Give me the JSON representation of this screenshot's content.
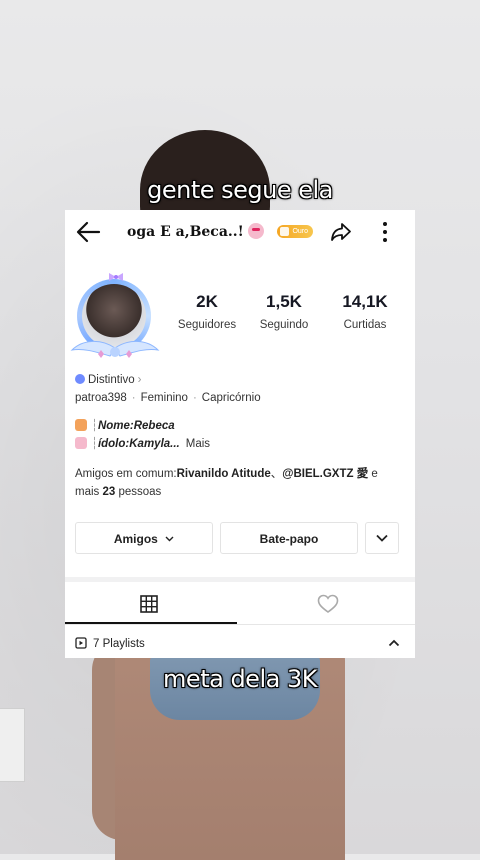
{
  "captions": {
    "top": "gente segue ela",
    "bottom": "meta dela 3K"
  },
  "profile": {
    "title": "oga E a,Beca..!",
    "badge": "Ouro",
    "stats": [
      {
        "value": "2K",
        "label": "Seguidores"
      },
      {
        "value": "1,5K",
        "label": "Seguindo"
      },
      {
        "value": "14,1K",
        "label": "Curtidas"
      }
    ],
    "distinctive": "Distintivo",
    "meta": [
      "patroa398",
      "Feminino",
      "Capricórnio"
    ],
    "bio": {
      "line1_key": "Nome",
      "line1_value": "Rebeca",
      "line2_key": "ídolo",
      "line2_value": "Kamyla...",
      "more": "Mais"
    },
    "friends": {
      "prefix": "Amigos em comum:",
      "name1": "Rivanildo Atitude",
      "sep": "、",
      "name2": "@BIEL.GXTZ 愛",
      "suffix1": " e",
      "line2_prefix": "mais ",
      "count": "23",
      "line2_suffix": " pessoas"
    },
    "buttons": {
      "friends": "Amigos",
      "chat": "Bate-papo"
    },
    "playlists": "7 Playlists"
  },
  "colors": {
    "accent_gold": "#f5a623",
    "ring_blue": "#7fb3ff"
  }
}
